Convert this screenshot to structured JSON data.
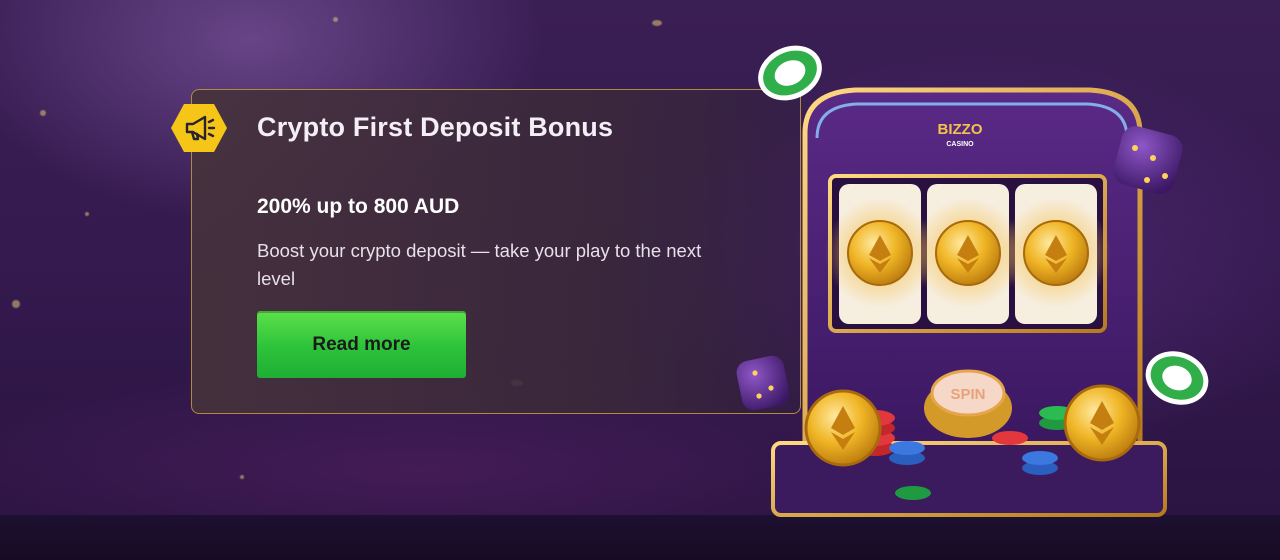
{
  "promo": {
    "title": "Crypto First Deposit Bonus",
    "subtitle": "200% up to 800 AUD",
    "description": "Boost your crypto deposit — take your play to the next level",
    "button_label": "Read more",
    "badge_icon": "megaphone-icon"
  },
  "slot_machine": {
    "brand": "BIZZO",
    "brand_sub": "CASINO",
    "spin_label": "SPIN",
    "reel_symbol": "ethereum-coin-icon"
  },
  "colors": {
    "background": "#33194d",
    "card_border": "#b08a3e",
    "badge": "#f5c518",
    "button": "#2cc33a",
    "gold": "#e8a920"
  }
}
